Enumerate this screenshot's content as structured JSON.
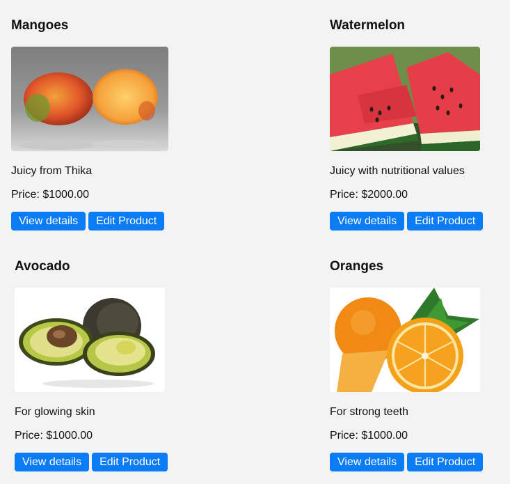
{
  "products": [
    {
      "name": "Mangoes",
      "image_label": "Mangoes",
      "description": "Juicy from Thika",
      "price": "Price: $1000.00",
      "view_label": "View details",
      "edit_label": "Edit Product"
    },
    {
      "name": "Watermelon",
      "image_label": "Watermelon",
      "description": "Juicy with nutritional values",
      "price": "Price: $2000.00",
      "view_label": "View details",
      "edit_label": "Edit Product"
    },
    {
      "name": "Avocado",
      "image_label": "Avocado",
      "description": "For glowing skin",
      "price": "Price: $1000.00",
      "view_label": "View details",
      "edit_label": "Edit Product"
    },
    {
      "name": "Oranges",
      "image_label": "Oranges",
      "description": "For strong teeth",
      "price": "Price: $1000.00",
      "view_label": "View details",
      "edit_label": "Edit Product"
    }
  ],
  "colors": {
    "page_background": "#f3f3f3",
    "button": "#0a7cf5",
    "button_text": "#ffffff"
  }
}
